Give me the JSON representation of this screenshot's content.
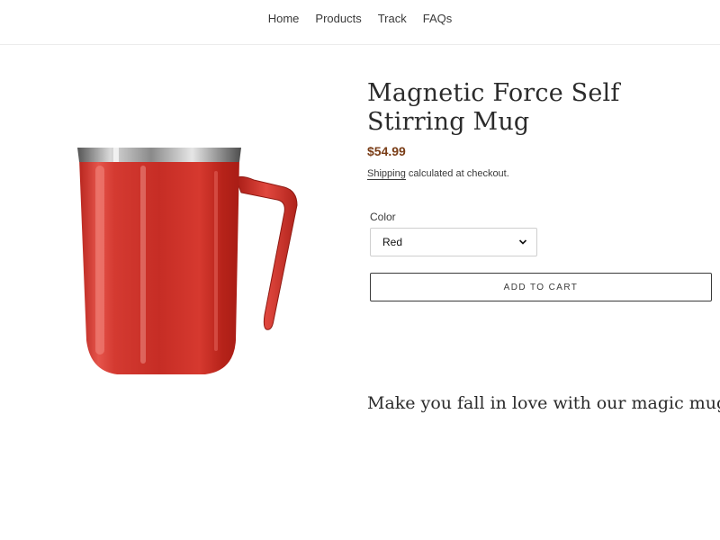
{
  "nav": {
    "items": [
      {
        "label": "Home"
      },
      {
        "label": "Products"
      },
      {
        "label": "Track"
      },
      {
        "label": "FAQs"
      }
    ]
  },
  "product": {
    "image_alt": "red-stainless-mug-icon",
    "title": "Magnetic Force Self Stirring Mug",
    "price": "$54.99",
    "shipping_link": "Shipping",
    "shipping_text": " calculated at checkout."
  },
  "options": {
    "color_label": "Color",
    "color_value": "Red"
  },
  "cart": {
    "add_label": "ADD TO CART"
  },
  "description": {
    "tagline": "Make you fall in love with our magic mug"
  },
  "colors": {
    "price": "#7a3d17",
    "mug": "#c9302a"
  }
}
